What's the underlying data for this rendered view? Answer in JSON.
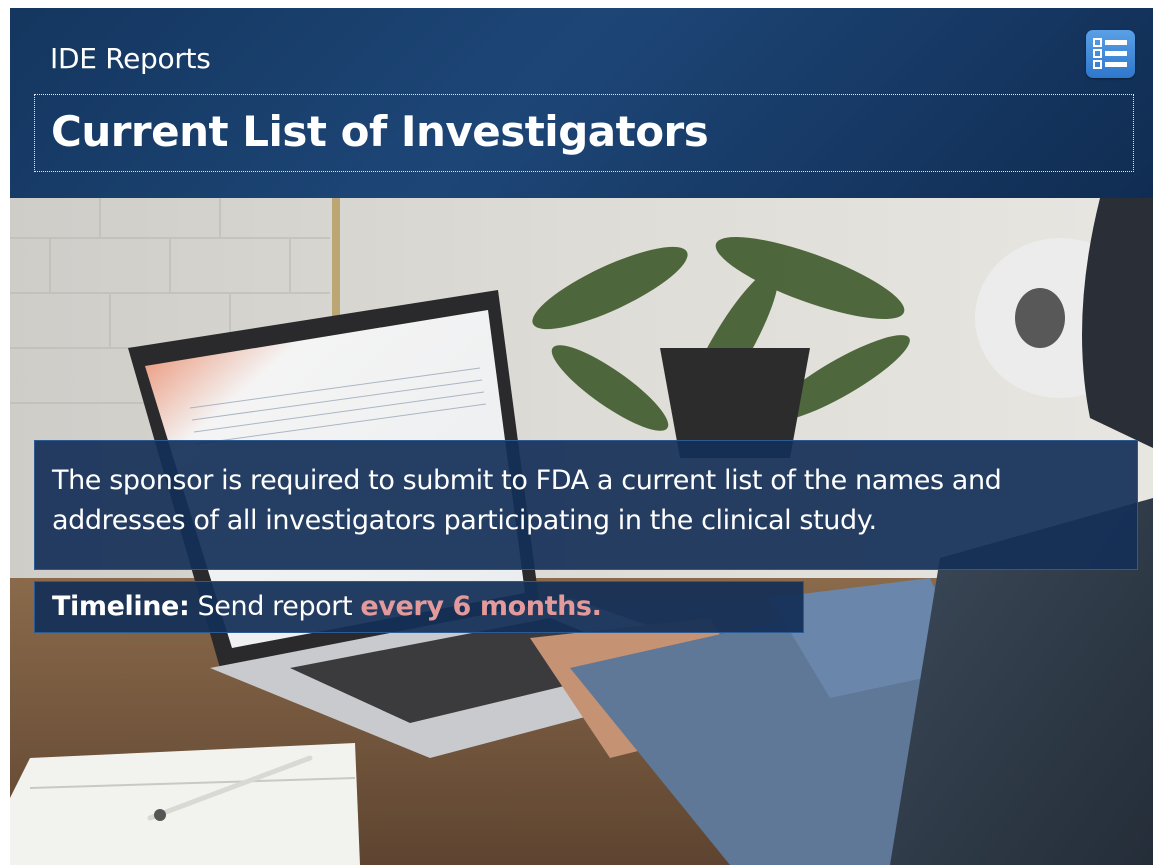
{
  "header": {
    "section": "IDE Reports",
    "title": "Current List of Investigators",
    "menu_icon": "list-menu-icon"
  },
  "info": {
    "text": "The sponsor is required to submit to FDA a current list of the names and addresses of all investigators participating in the clinical study."
  },
  "timeline": {
    "label": "Timeline:",
    "text": " Send report ",
    "highlight": "every 6 months."
  },
  "colors": {
    "header_bg": "#1a3f6e",
    "panel_bg": "#132f57",
    "menu_button": "#4a90dc",
    "highlight": "#e49a9a"
  }
}
